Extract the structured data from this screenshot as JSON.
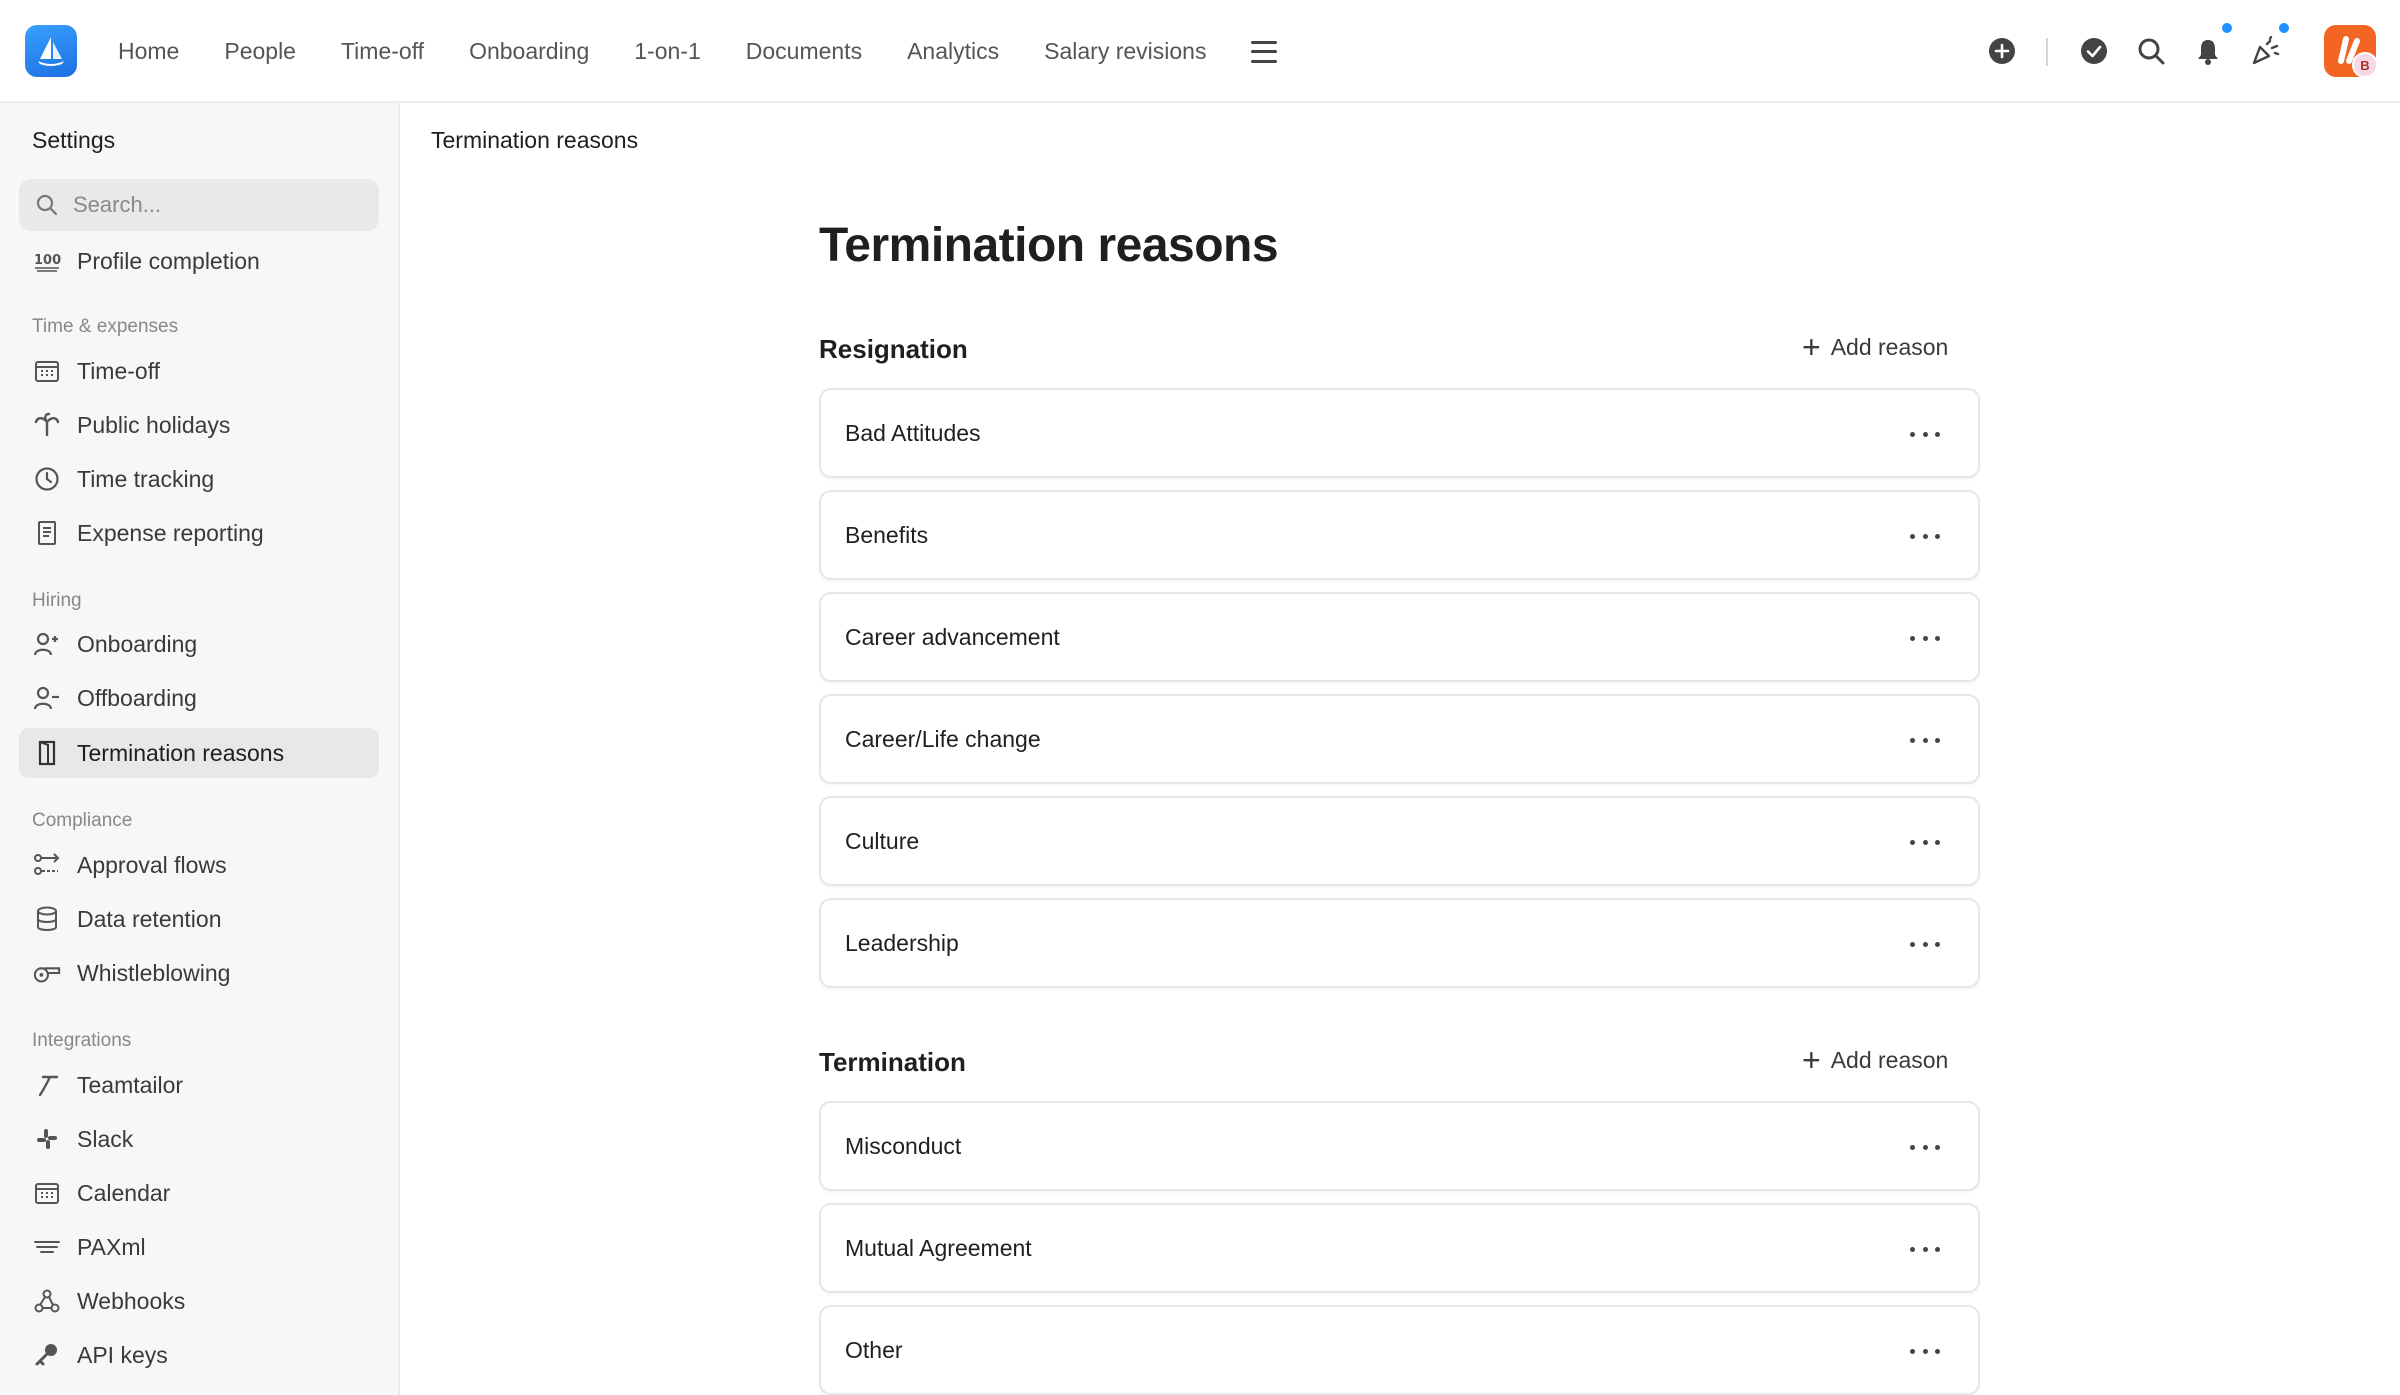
{
  "nav": {
    "items": [
      "Home",
      "People",
      "Time-off",
      "Onboarding",
      "1-on-1",
      "Documents",
      "Analytics",
      "Salary revisions"
    ]
  },
  "topbar": {
    "avatar_badge": "B"
  },
  "sidebar": {
    "title": "Settings",
    "search_placeholder": "Search...",
    "profile_completion": "Profile completion",
    "sections": {
      "time_expenses": "Time & expenses",
      "hiring": "Hiring",
      "compliance": "Compliance",
      "integrations": "Integrations"
    },
    "items": {
      "time_off": "Time-off",
      "public_holidays": "Public holidays",
      "time_tracking": "Time tracking",
      "expense_reporting": "Expense reporting",
      "onboarding": "Onboarding",
      "offboarding": "Offboarding",
      "termination_reasons": "Termination reasons",
      "approval_flows": "Approval flows",
      "data_retention": "Data retention",
      "whistleblowing": "Whistleblowing",
      "teamtailor": "Teamtailor",
      "slack": "Slack",
      "calendar": "Calendar",
      "paxml": "PAXml",
      "webhooks": "Webhooks",
      "api_keys": "API keys"
    }
  },
  "main": {
    "breadcrumb": "Termination reasons",
    "title": "Termination reasons",
    "add_reason_label": "Add reason",
    "resignation": {
      "title": "Resignation",
      "reasons": [
        "Bad Attitudes",
        "Benefits",
        "Career advancement",
        "Career/Life change",
        "Culture",
        "Leadership"
      ]
    },
    "termination": {
      "title": "Termination",
      "reasons": [
        "Misconduct",
        "Mutual Agreement",
        "Other"
      ]
    }
  },
  "colors": {
    "accent": "#1e90ff",
    "avatar": "#f26522",
    "logo": "#2b86f0"
  }
}
